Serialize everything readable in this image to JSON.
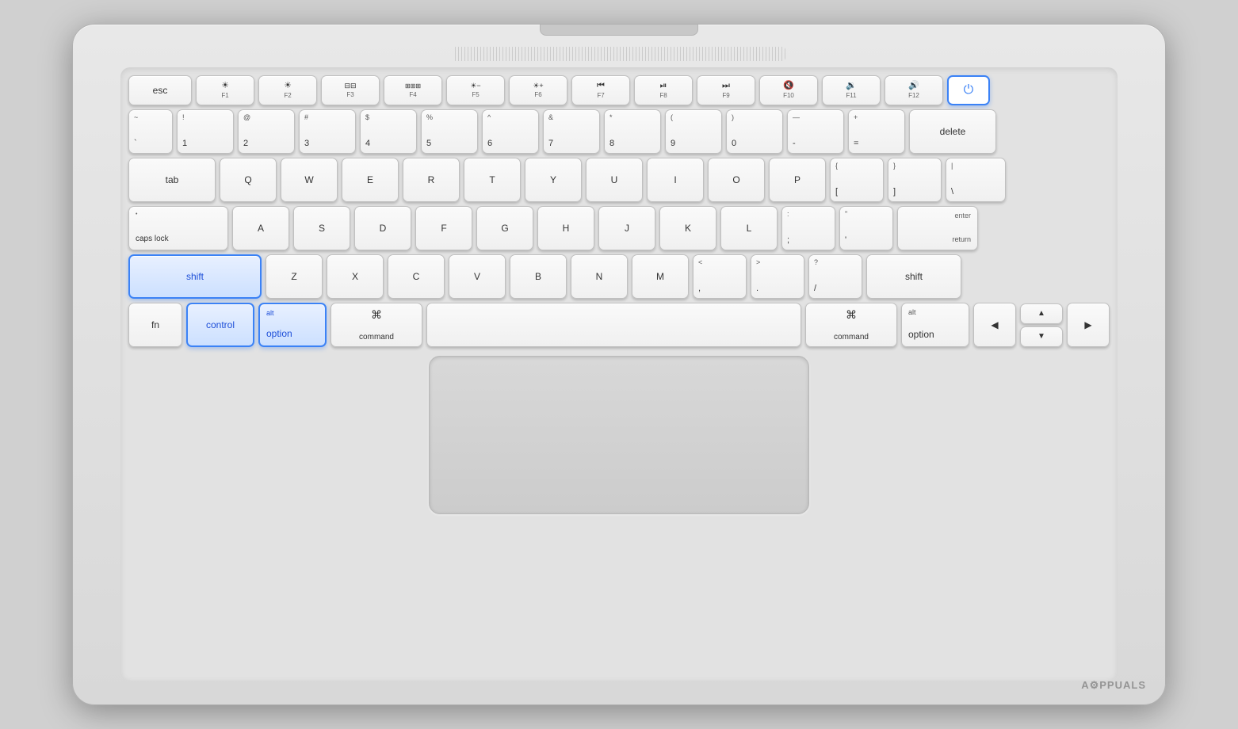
{
  "laptop": {
    "body_color": "#e0e0e0"
  },
  "keyboard": {
    "rows": {
      "fn_row": {
        "keys": [
          {
            "id": "esc",
            "label": "esc",
            "width": "esc",
            "highlighted": false
          },
          {
            "id": "f1",
            "top": "☀",
            "label": "F1"
          },
          {
            "id": "f2",
            "top": "☀",
            "label": "F2"
          },
          {
            "id": "f3",
            "top": "⊞",
            "label": "F3"
          },
          {
            "id": "f4",
            "top": "⊞⊞⊞",
            "label": "F4"
          },
          {
            "id": "f5",
            "top": "☀-",
            "label": "F5"
          },
          {
            "id": "f6",
            "top": "☀+",
            "label": "F6"
          },
          {
            "id": "f7",
            "top": "⏮",
            "label": "F7"
          },
          {
            "id": "f8",
            "top": "⏯",
            "label": "F8"
          },
          {
            "id": "f9",
            "top": "⏭",
            "label": "F9"
          },
          {
            "id": "f10",
            "top": "🔇",
            "label": "F10"
          },
          {
            "id": "f11",
            "top": "🔉",
            "label": "F11"
          },
          {
            "id": "f12",
            "top": "🔊",
            "label": "F12"
          },
          {
            "id": "power",
            "label": "⏻",
            "highlighted": true
          }
        ]
      },
      "number_row": {
        "keys": [
          {
            "id": "tilde",
            "top": "~",
            "bottom": "`"
          },
          {
            "id": "1",
            "top": "!",
            "bottom": "1"
          },
          {
            "id": "2",
            "top": "@",
            "bottom": "2"
          },
          {
            "id": "3",
            "top": "#",
            "bottom": "3"
          },
          {
            "id": "4",
            "top": "$",
            "bottom": "4"
          },
          {
            "id": "5",
            "top": "%",
            "bottom": "5"
          },
          {
            "id": "6",
            "top": "^",
            "bottom": "6"
          },
          {
            "id": "7",
            "top": "&",
            "bottom": "7"
          },
          {
            "id": "8",
            "top": "*",
            "bottom": "8"
          },
          {
            "id": "9",
            "top": "(",
            "bottom": "9"
          },
          {
            "id": "0",
            "top": ")",
            "bottom": "0"
          },
          {
            "id": "minus",
            "top": "—",
            "bottom": "-"
          },
          {
            "id": "equals",
            "top": "+",
            "bottom": "="
          },
          {
            "id": "delete",
            "label": "delete",
            "wide": true
          }
        ]
      },
      "qwerty_row": {
        "prefix": "tab",
        "keys": [
          "Q",
          "W",
          "E",
          "R",
          "T",
          "Y",
          "U",
          "I",
          "O",
          "P"
        ],
        "suffix_keys": [
          {
            "id": "open_bracket",
            "top": "{",
            "bottom": "["
          },
          {
            "id": "close_bracket",
            "top": "}",
            "bottom": "]"
          },
          {
            "id": "backslash",
            "top": "|",
            "bottom": "\\"
          }
        ]
      },
      "asdf_row": {
        "prefix": "caps lock",
        "keys": [
          "A",
          "S",
          "D",
          "F",
          "G",
          "H",
          "J",
          "K",
          "L"
        ],
        "suffix_keys": [
          {
            "id": "semicolon",
            "top": ":",
            "bottom": ";"
          },
          {
            "id": "quote",
            "top": "\"",
            "bottom": "'"
          }
        ],
        "enter": true
      },
      "zxcv_row": {
        "prefix": "shift",
        "prefix_highlighted": true,
        "keys": [
          "Z",
          "X",
          "C",
          "V",
          "B",
          "N",
          "M"
        ],
        "suffix_keys": [
          {
            "id": "comma",
            "top": "<",
            "bottom": ","
          },
          {
            "id": "period",
            "top": ">",
            "bottom": "."
          },
          {
            "id": "slash",
            "top": "?",
            "bottom": "/"
          }
        ],
        "suffix": "shift"
      },
      "bottom_row": {
        "keys": [
          {
            "id": "fn",
            "label": "fn",
            "highlighted": false
          },
          {
            "id": "control",
            "label": "control",
            "highlighted": true
          },
          {
            "id": "option_left",
            "top": "alt",
            "label": "option",
            "highlighted": true
          },
          {
            "id": "command_left",
            "top": "⌘",
            "label": "command",
            "highlighted": false
          },
          {
            "id": "space",
            "label": ""
          },
          {
            "id": "command_right",
            "top": "⌘",
            "label": "command",
            "highlighted": false
          },
          {
            "id": "option_right",
            "top": "alt",
            "label": "option",
            "highlighted": false
          },
          {
            "id": "arrow_left",
            "label": "◀"
          },
          {
            "id": "arrow_up",
            "label": "▲"
          },
          {
            "id": "arrow_down",
            "label": "▼"
          },
          {
            "id": "arrow_right",
            "label": "▶"
          }
        ]
      }
    }
  },
  "watermark": "A⚙PPUALS"
}
